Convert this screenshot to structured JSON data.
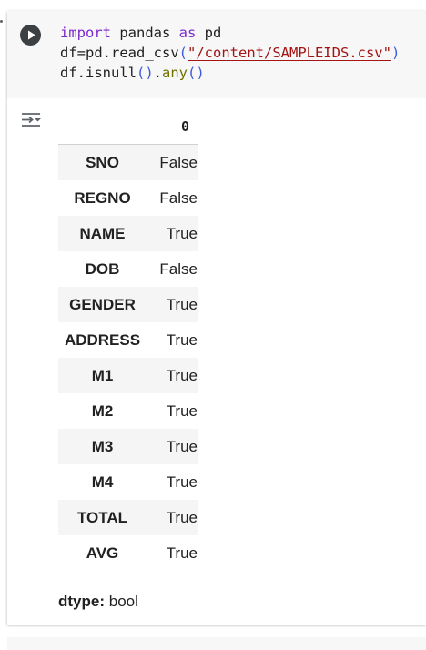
{
  "code_cell": {
    "lines": [
      [
        {
          "text": "import",
          "kind": "kw"
        },
        {
          "text": " pandas ",
          "kind": "plain"
        },
        {
          "text": "as",
          "kind": "kw"
        },
        {
          "text": " pd",
          "kind": "plain"
        }
      ],
      [
        {
          "text": "df=pd.read_csv",
          "kind": "plain"
        },
        {
          "text": "(",
          "kind": "paren"
        },
        {
          "text": "\"/content/SAMPLEIDS.csv\"",
          "kind": "str"
        },
        {
          "text": ")",
          "kind": "paren"
        }
      ],
      [
        {
          "text": "df.isnull",
          "kind": "plain"
        },
        {
          "text": "()",
          "kind": "paren"
        },
        {
          "text": ".",
          "kind": "plain"
        },
        {
          "text": "any",
          "kind": "fn"
        },
        {
          "text": "()",
          "kind": "paren"
        }
      ]
    ],
    "run_icon": "play-icon"
  },
  "output": {
    "toggle_icon": "output-toggle-icon",
    "table": {
      "column_header": "0",
      "rows": [
        {
          "index": "SNO",
          "value": "False"
        },
        {
          "index": "REGNO",
          "value": "False"
        },
        {
          "index": "NAME",
          "value": "True"
        },
        {
          "index": "DOB",
          "value": "False"
        },
        {
          "index": "GENDER",
          "value": "True"
        },
        {
          "index": "ADDRESS",
          "value": "True"
        },
        {
          "index": "M1",
          "value": "True"
        },
        {
          "index": "M2",
          "value": "True"
        },
        {
          "index": "M3",
          "value": "True"
        },
        {
          "index": "M4",
          "value": "True"
        },
        {
          "index": "TOTAL",
          "value": "True"
        },
        {
          "index": "AVG",
          "value": "True"
        }
      ]
    },
    "dtype_label": "dtype:",
    "dtype_value": "bool"
  },
  "colors": {
    "keyword": "#7c29c9",
    "string": "#a31515",
    "paren": "#3b5bdb",
    "function": "#6f6f00",
    "run_button": "#3c4043",
    "stripe": "#f5f5f5"
  }
}
